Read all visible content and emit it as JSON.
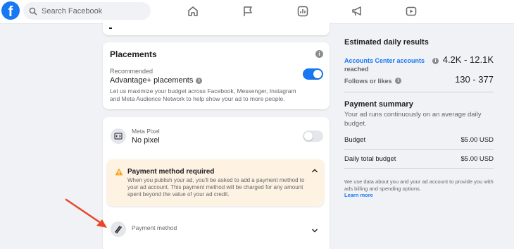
{
  "topbar": {
    "logo": "f",
    "search_placeholder": "Search Facebook",
    "nav_icons": [
      "home-icon",
      "flag-icon",
      "insights-icon",
      "megaphone-icon",
      "video-icon"
    ]
  },
  "placements": {
    "title": "Placements",
    "recommended_label": "Recommended",
    "option_label": "Advantage+ placements",
    "description": "Let us maximize your budget across Facebook, Messenger, Instagram and Meta Audience Network to help show your ad to more people.",
    "toggle_on": true
  },
  "pixel": {
    "label": "Meta Pixel",
    "value": "No pixel",
    "toggle_on": false
  },
  "payment_warning": {
    "title": "Payment method required",
    "body": "When you publish your ad, you'll be asked to add a payment method to your ad account. This payment method will be charged for any amount spent beyond the value of your ad credit."
  },
  "payment_method": {
    "label": "Payment method"
  },
  "estimated": {
    "title": "Estimated daily results",
    "accounts_label": "Accounts Center accounts",
    "accounts_sub": "reached",
    "accounts_value": "4.2K - 12.1K",
    "follows_label": "Follows or likes",
    "follows_value": "130 - 377"
  },
  "summary": {
    "title": "Payment summary",
    "description": "Your ad runs continuously on an average daily budget.",
    "rows": [
      {
        "label": "Budget",
        "value": "$5.00 USD"
      },
      {
        "label": "Daily total budget",
        "value": "$5.00 USD"
      }
    ],
    "footnote": "We use data about you and your ad account to provide you with ads billing and spending options.",
    "learn_more": "Learn more"
  },
  "colors": {
    "brand": "#1877f2",
    "warning": "#f5a623",
    "arrow": "#e8472a"
  }
}
